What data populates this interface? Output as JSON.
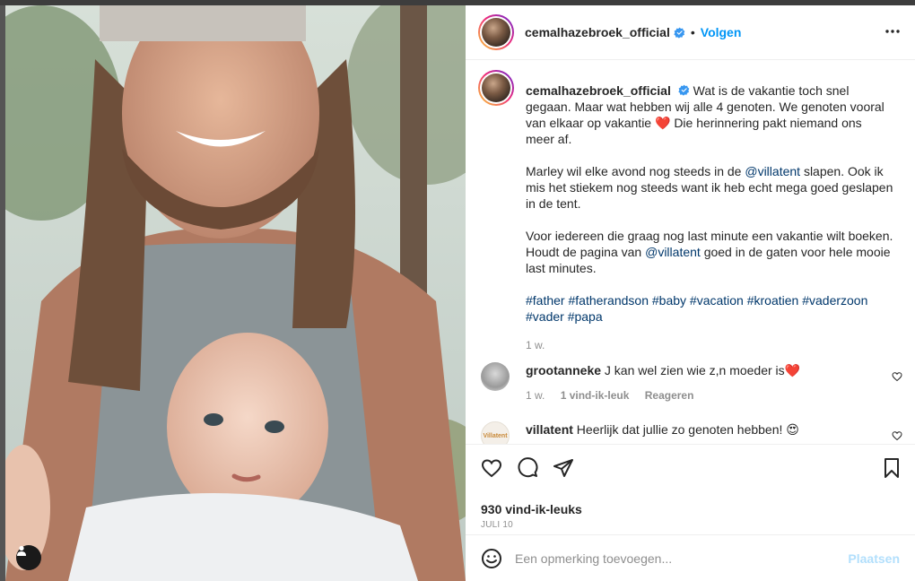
{
  "post": {
    "author": "cemalhazebroek_official",
    "separator": "•",
    "follow_label": "Volgen",
    "caption_para1": "Wat is de vakantie toch snel gegaan. Maar wat hebben wij alle 4 genoten. We genoten vooral van elkaar op vakantie",
    "caption_para1_end": "Die herinnering pakt niemand ons meer af.",
    "caption_para2_a": "Marley wil elke avond nog steeds in de",
    "mention": "@villatent",
    "caption_para2_b": "slapen. Ook ik mis het stiekem nog steeds want ik heb echt mega goed geslapen in de tent.",
    "caption_para3_a": "Voor iedereen die graag nog last minute een vakantie wilt boeken. Houdt de pagina van",
    "caption_para3_b": "goed in de gaten voor hele mooie last minutes.",
    "hashtags": "#father #fatherandson #baby #vacation #kroatien #vaderzoon #vader #papa",
    "caption_time": "1 w.",
    "heart_emoji": "❤️"
  },
  "comments": [
    {
      "user": "grootanneke",
      "text": "J kan wel zien wie z,n moeder is",
      "emoji": "❤️",
      "time": "1 w.",
      "likes": "1 vind-ik-leuk",
      "reply": "Reageren"
    },
    {
      "user": "villatent",
      "text": "Heerlijk dat jullie zo genoten hebben!",
      "emoji": "😍",
      "avatar_text": "Villatent"
    }
  ],
  "actions": {
    "likes": "930 vind-ik-leuks",
    "date": "JULI 10"
  },
  "add_comment": {
    "placeholder": "Een opmerking toevoegen...",
    "post_label": "Plaatsen"
  },
  "colors": {
    "accent": "#0095f6",
    "link": "#00376b",
    "muted": "#8e8e8e",
    "post_disabled": "#b2dffc"
  }
}
